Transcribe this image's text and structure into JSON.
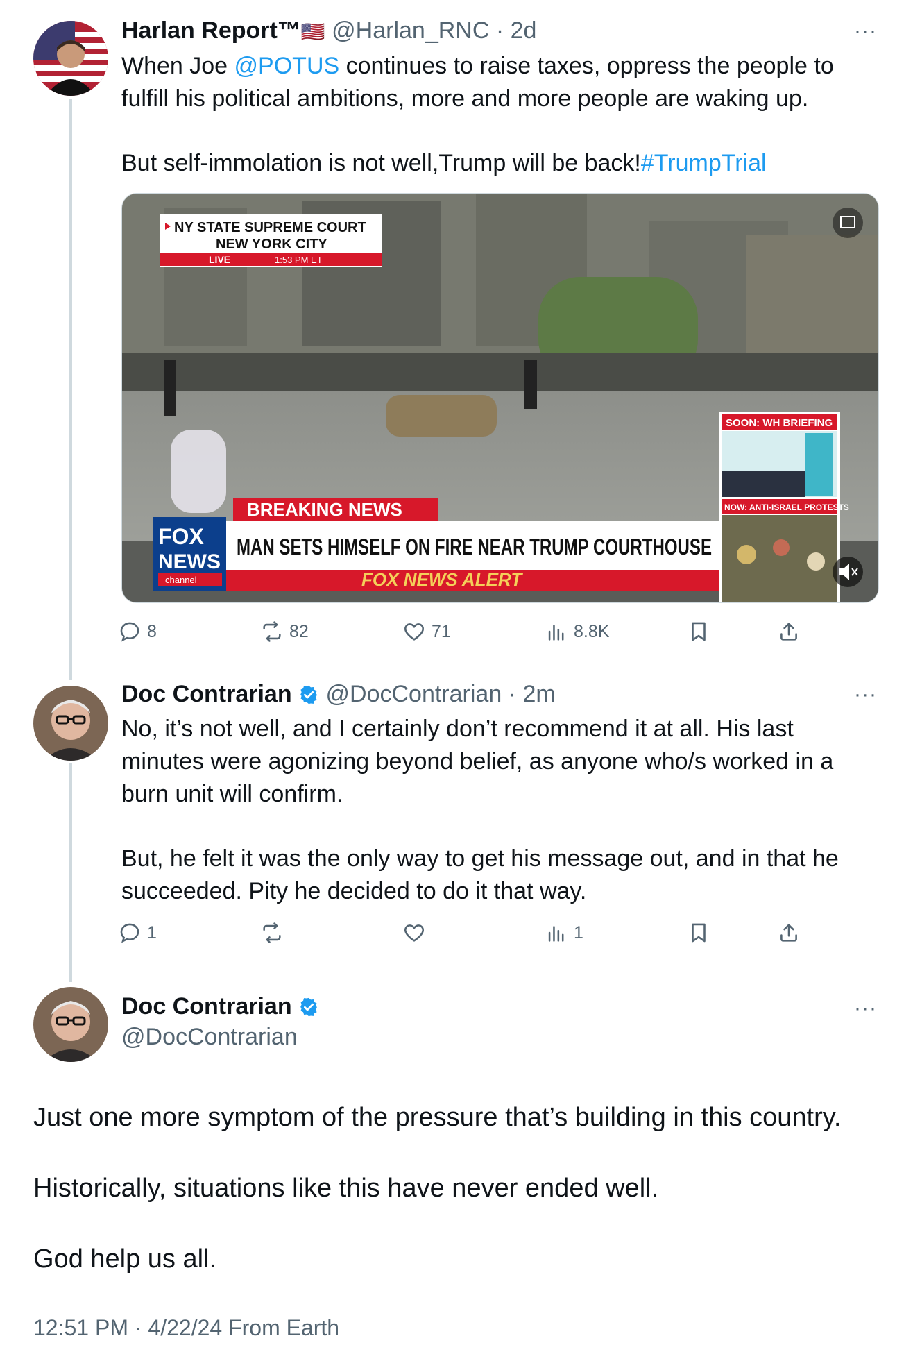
{
  "tweet1": {
    "name": "Harlan Report™",
    "flag": "🇺🇸",
    "handle": "@Harlan_RNC",
    "time": "2d",
    "more": "···",
    "text_prefix": "When Joe ",
    "mention": "@POTUS",
    "text_rest": " continues to raise taxes, oppress the people to fulfill his political ambitions, more and more people are waking up.",
    "text2_prefix": "But self-immolation is not well,Trump will be back!",
    "hashtag": "#TrumpTrial",
    "media": {
      "court_line1": "NY STATE SUPREME COURT",
      "court_line2": "NEW YORK CITY",
      "live_label": "LIVE",
      "live_time": "1:53 PM ET",
      "breaking": "BREAKING NEWS",
      "headline": "MAN SETS HIMSELF ON FIRE NEAR TRUMP COURTHOUSE",
      "alert": "FOX NEWS ALERT",
      "logo_top": "FOX",
      "logo_bottom": "NEWS",
      "logo_sub": "channel",
      "soon": "SOON: WH BRIEFING",
      "now": "NOW: ANTI-ISRAEL PROTESTS"
    },
    "stats": {
      "replies": "8",
      "reposts": "82",
      "likes": "71",
      "views": "8.8K"
    }
  },
  "tweet2": {
    "name": "Doc Contrarian",
    "handle": "@DocContrarian",
    "time": "2m",
    "more": "···",
    "para1": "No, it’s not well, and I certainly don’t recommend it at all. His last minutes were agonizing beyond belief, as anyone who/s worked in a burn unit will confirm.",
    "para2": "But, he felt it was the only way to get his message out, and in that he succeeded. Pity he decided to do it that way.",
    "stats": {
      "replies": "1",
      "reposts": "",
      "likes": "",
      "views": "1"
    }
  },
  "tweet3": {
    "name": "Doc Contrarian",
    "handle": "@DocContrarian",
    "more": "···",
    "para1": "Just one more symptom of the pressure that’s building in this country.",
    "para2": "Historically, situations like this have never ended well.",
    "para3": "God help us all.",
    "footer": "12:51 PM · 4/22/24 From Earth"
  },
  "colors": {
    "accent": "#1d9bf0",
    "muted": "#536471",
    "verified": "#1d9bf0",
    "fox_red": "#d7182a"
  }
}
